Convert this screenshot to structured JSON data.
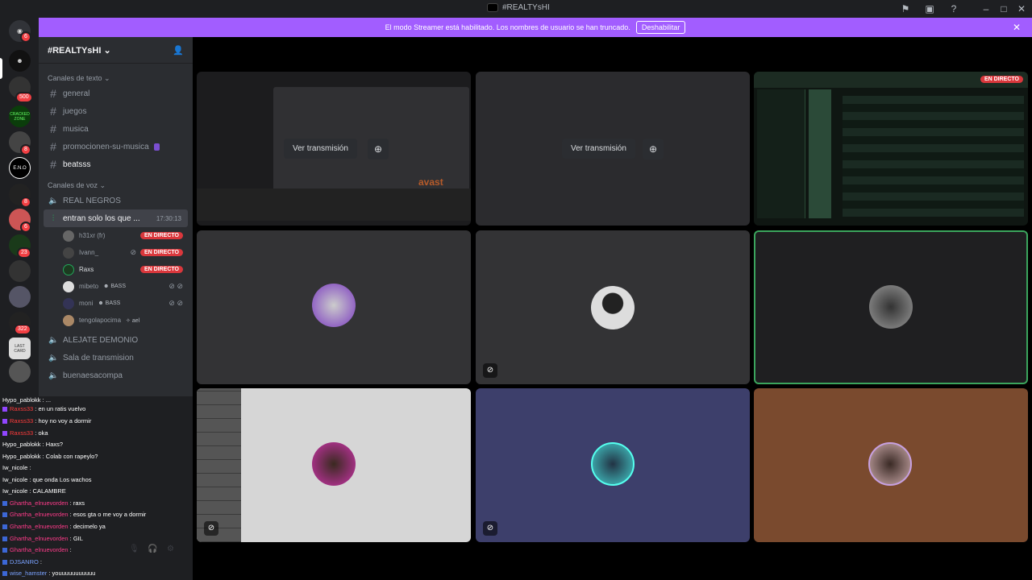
{
  "window": {
    "title": "#REALTYsHI"
  },
  "banner": {
    "text": "El modo Streamer está habilitado. Los nombres de usuario se han truncado.",
    "button": "Deshabilitar"
  },
  "guilds": {
    "badges": [
      "6",
      "500",
      "8",
      "8",
      "6",
      "23",
      "322"
    ],
    "labels": [
      "CRACKED ZONE",
      "E.N.O",
      "LAST CARD"
    ]
  },
  "server": {
    "name": "#REALTYsHI",
    "text_category": "Canales de texto",
    "text_channels": [
      "general",
      "juegos",
      "musica",
      "promocionen-su-musica",
      "beatsss"
    ],
    "voice_category": "Canales de voz",
    "voice_channels": {
      "first": "REAL NEGROS",
      "active": "entran solo los que ...",
      "active_timer": "17:30:13",
      "after": [
        "ALEJATE DEMONIO",
        "Sala de transmision",
        "buenaesacompa"
      ]
    },
    "voice_users": [
      {
        "name": "h31xr (fr)",
        "live": "EN DIRECTO"
      },
      {
        "name": "Ivann_",
        "live": "EN DIRECTO"
      },
      {
        "name": "Raxs",
        "live": "EN DIRECTO"
      },
      {
        "name": "mibeto",
        "tag": "BASS"
      },
      {
        "name": "moni",
        "tag": "BASS"
      },
      {
        "name": "tengolapocima",
        "tag": "ael"
      }
    ]
  },
  "chat": [
    {
      "user": "Hypo_pablokk",
      "text": "...",
      "color": "white"
    },
    {
      "user": "Raxss33",
      "text": "en un ratis vuelvo",
      "color": "red"
    },
    {
      "user": "Raxss33",
      "text": "hoy no voy a dormir",
      "color": "red"
    },
    {
      "user": "Raxss33",
      "text": "oka",
      "color": "red"
    },
    {
      "user": "Hypo_pablokk",
      "text": "Haxs?",
      "color": "white"
    },
    {
      "user": "Hypo_pablokk",
      "text": "Colab con rapeylo?",
      "color": "white"
    },
    {
      "user": "Iw_nicole",
      "text": "",
      "color": "white"
    },
    {
      "user": "Iw_nicole",
      "text": "que onda Los wachos",
      "color": "white"
    },
    {
      "user": "Iw_nicole",
      "text": "CALAMBRE",
      "color": "white"
    },
    {
      "user": "Ghartha_elnuevorden",
      "text": "raxs",
      "color": "pink"
    },
    {
      "user": "Ghartha_elnuevorden",
      "text": "esos gta o me voy a dormir",
      "color": "pink"
    },
    {
      "user": "Ghartha_elnuevorden",
      "text": "decimelo ya",
      "color": "pink"
    },
    {
      "user": "Ghartha_elnuevorden",
      "text": "GIL",
      "color": "pink"
    },
    {
      "user": "Ghartha_elnuevorden",
      "text": "",
      "color": "pink"
    },
    {
      "user": "DJSANRO",
      "text": "",
      "color": "blue"
    },
    {
      "user": "wise_hamster",
      "text": "youuuuuuuuuuu",
      "color": "blue"
    }
  ],
  "stage": {
    "view_stream": "Ver transmisión",
    "live_label": "EN DIRECTO",
    "screen_text": "avast"
  },
  "colors": {
    "accent": "#a25dff",
    "live": "#da373c",
    "speaking": "#3ba55d"
  }
}
